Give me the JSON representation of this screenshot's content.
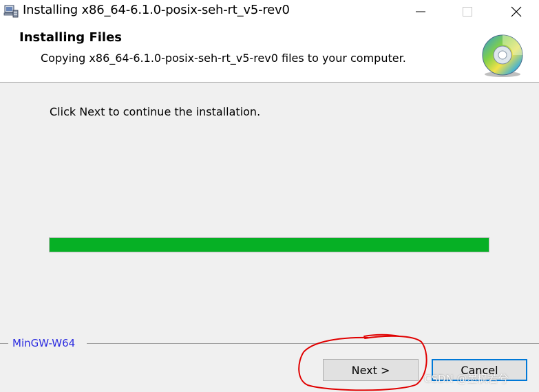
{
  "window": {
    "title": "Installing x86_64-6.1.0-posix-seh-rt_v5-rev0",
    "icon": "installer-icon"
  },
  "header": {
    "title": "Installing Files",
    "subtitle": "Copying x86_64-6.1.0-posix-seh-rt_v5-rev0 files to your computer.",
    "icon": "cd-disc-icon"
  },
  "body": {
    "instruction": "Click Next to continue the installation.",
    "progress_percent": 100
  },
  "footer": {
    "brand": "MinGW-W64",
    "next_label": "Next >",
    "cancel_label": "Cancel"
  },
  "watermark": "CSDN @墨枫若兮",
  "colors": {
    "progress_fill": "#06b025",
    "brand_text": "#2d2de0",
    "annotation": "#e00000",
    "focus_border": "#0078d7"
  }
}
